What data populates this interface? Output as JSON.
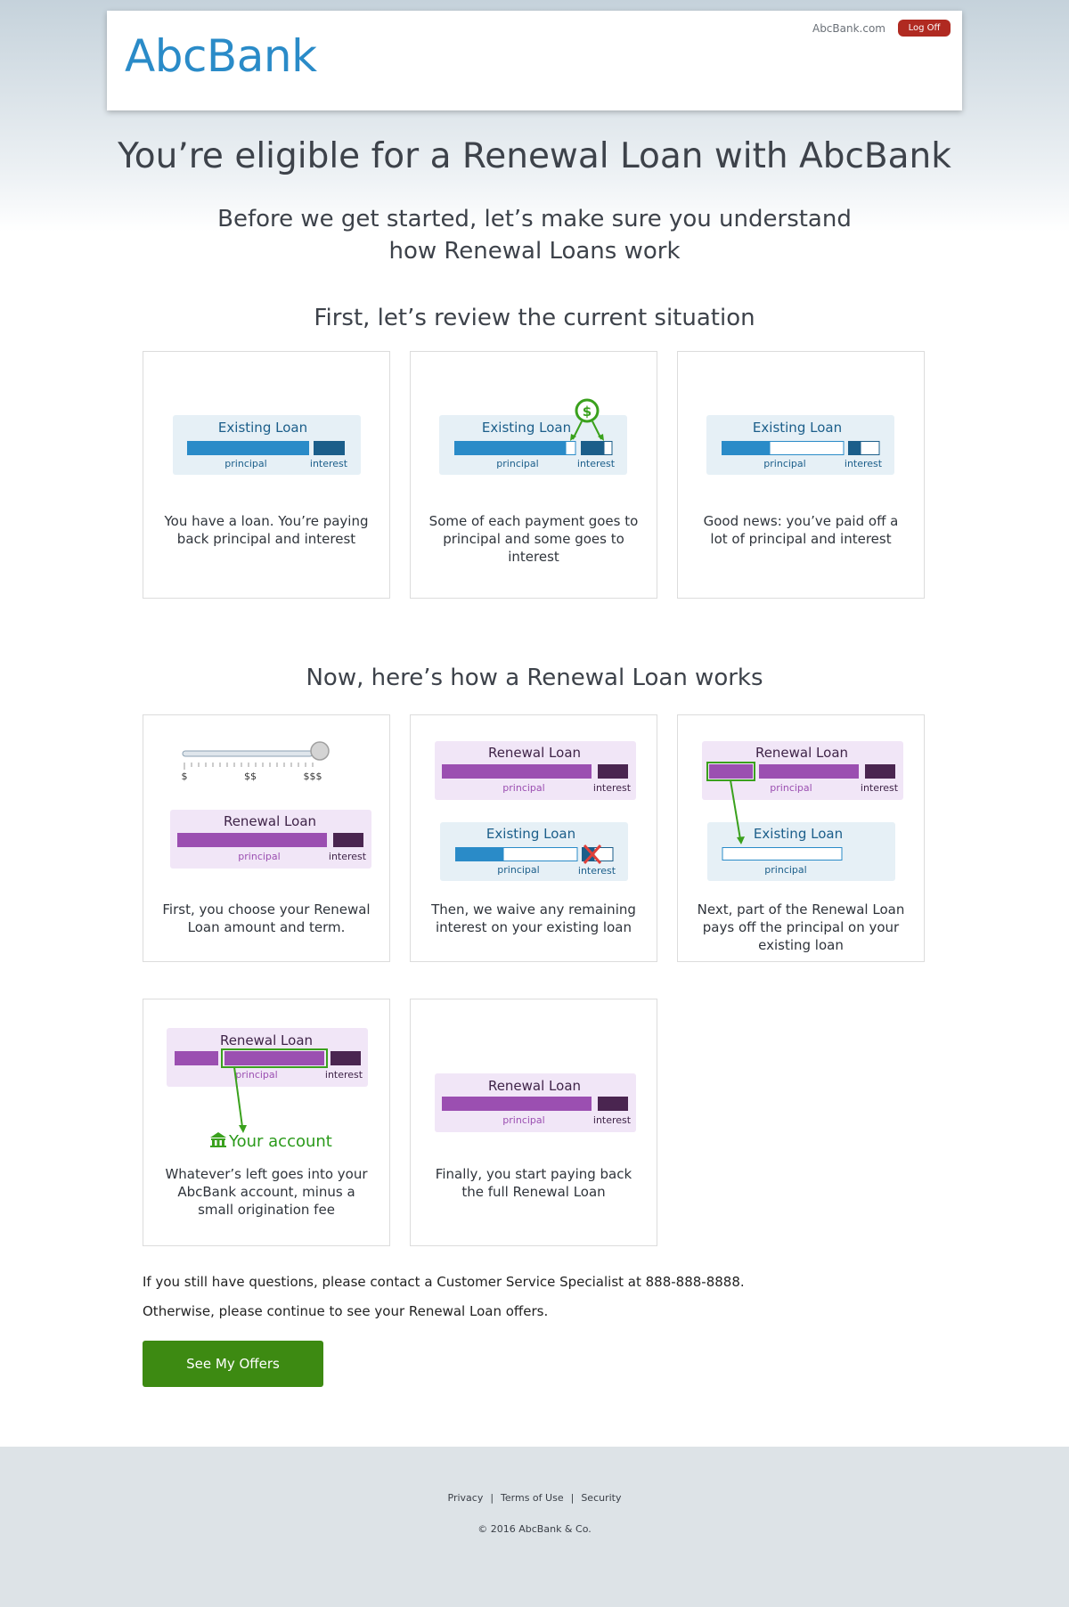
{
  "header": {
    "logo": "AbcBank",
    "site_link": "AbcBank.com",
    "logoff_label": "Log Off"
  },
  "title": "You’re eligible for a Renewal Loan with AbcBank",
  "subtitle_line1": "Before we get started, let’s make sure you understand",
  "subtitle_line2": "how Renewal Loans work",
  "section1": {
    "title": "First, let’s review the current situation",
    "cards": [
      {
        "caption": "You have a loan. You’re paying back principal and interest"
      },
      {
        "caption": "Some of each payment goes to principal and some goes to interest"
      },
      {
        "caption": "Good news: you’ve paid off a lot of principal and interest"
      }
    ]
  },
  "section2": {
    "title": "Now, here’s how a Renewal Loan works",
    "cards": [
      {
        "caption": "First, you choose your Renewal Loan amount and term."
      },
      {
        "caption": "Then, we waive any remaining interest on your existing loan"
      },
      {
        "caption": "Next, part of the Renewal Loan pays off the principal on your existing loan"
      },
      {
        "caption": "Whatever’s left goes into your AbcBank account, minus a small origination fee"
      },
      {
        "caption": "Finally, you start paying back the full Renewal Loan"
      }
    ]
  },
  "diagram_labels": {
    "existing_loan": "Existing Loan",
    "renewal_loan": "Renewal Loan",
    "principal": "principal",
    "interest": "interest",
    "your_account": "Your account",
    "dollar": "$",
    "slider_low": "$",
    "slider_mid": "$$",
    "slider_high": "$$$"
  },
  "contact_text": "If you still have questions, please contact a Customer Service Specialist at 888-888-8888.",
  "continue_text": "Otherwise, please continue to see your Renewal Loan offers.",
  "offers_button": "See My Offers",
  "footer": {
    "links": [
      "Privacy",
      "Terms of Use",
      "Security"
    ],
    "copyright": "© 2016 AbcBank & Co."
  },
  "colors": {
    "brand_blue": "#2a8bc8",
    "interest_dark_blue": "#1b5e8a",
    "existing_panel": "#e6f0f6",
    "renewal_panel": "#f1e6f7",
    "renewal_principal": "#9b4fb1",
    "renewal_interest": "#4a2550",
    "action_green": "#3d8a12",
    "logoff_red": "#b02a21"
  }
}
